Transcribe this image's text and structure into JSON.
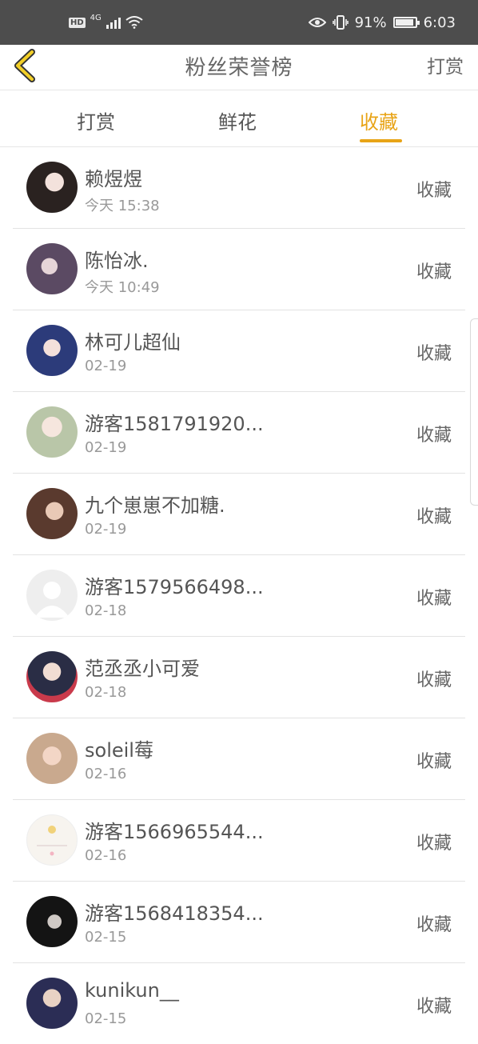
{
  "status_bar": {
    "hd": "HD",
    "network": "4G",
    "battery_text": "91%",
    "battery_level": 0.91,
    "time": "6:03"
  },
  "header": {
    "back_icon": "chevron-left-icon",
    "title": "粉丝荣誉榜",
    "action": "打赏"
  },
  "colors": {
    "accent": "#e8a417",
    "text": "#555555",
    "subtle": "#999999",
    "status_bar": "#4d4d4d"
  },
  "tabs": [
    {
      "label": "打赏",
      "active": false
    },
    {
      "label": "鲜花",
      "active": false
    },
    {
      "label": "收藏",
      "active": true
    }
  ],
  "fans": [
    {
      "name": "赖煜煜",
      "date": "今天 15:38",
      "action": "收藏",
      "avatar": "photo-avatar"
    },
    {
      "name": "陈怡冰.",
      "date": "今天 10:49",
      "action": "收藏",
      "avatar": "photo-avatar"
    },
    {
      "name": "林可儿超仙",
      "date": "02-19",
      "action": "收藏",
      "avatar": "photo-avatar"
    },
    {
      "name": "游客1581791920...",
      "date": "02-19",
      "action": "收藏",
      "avatar": "photo-avatar"
    },
    {
      "name": "九个崽崽不加糖.",
      "date": "02-19",
      "action": "收藏",
      "avatar": "photo-avatar"
    },
    {
      "name": "游客1579566498...",
      "date": "02-18",
      "action": "收藏",
      "avatar": "default-user-avatar"
    },
    {
      "name": "范丞丞小可爱",
      "date": "02-18",
      "action": "收藏",
      "avatar": "photo-avatar"
    },
    {
      "name": "soleil莓",
      "date": "02-16",
      "action": "收藏",
      "avatar": "photo-avatar"
    },
    {
      "name": "游客1566965544...",
      "date": "02-16",
      "action": "收藏",
      "avatar": "photo-avatar"
    },
    {
      "name": "游客1568418354...",
      "date": "02-15",
      "action": "收藏",
      "avatar": "photo-avatar"
    },
    {
      "name": "kunikun__",
      "date": "02-15",
      "action": "收藏",
      "avatar": "photo-avatar"
    }
  ]
}
